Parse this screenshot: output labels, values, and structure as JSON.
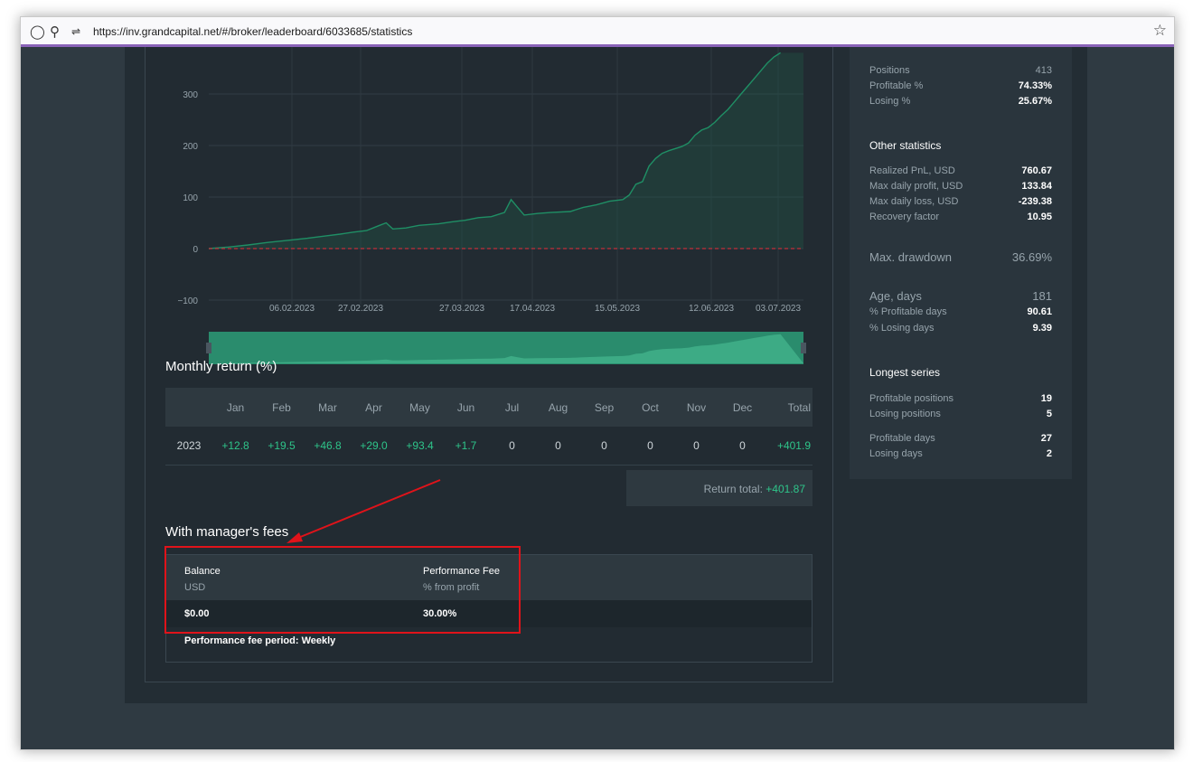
{
  "browser": {
    "url": "https://inv.grandcapital.net/#/broker/leaderboard/6033685/statistics"
  },
  "chart_data": {
    "type": "line",
    "yticks": [
      "300",
      "200",
      "100",
      "0",
      "−100"
    ],
    "xticks": [
      "06.02.2023",
      "27.02.2023",
      "27.03.2023",
      "17.04.2023",
      "15.05.2023",
      "12.06.2023",
      "03.07.2023"
    ],
    "ylim": [
      -100,
      380
    ],
    "grid": true,
    "series": [
      {
        "values": [
          [
            0,
            0
          ],
          [
            6,
            3
          ],
          [
            12,
            7
          ],
          [
            18,
            12
          ],
          [
            24,
            16
          ],
          [
            30,
            20
          ],
          [
            36,
            25
          ],
          [
            40,
            28
          ],
          [
            44,
            32
          ],
          [
            48,
            35
          ],
          [
            50,
            40
          ],
          [
            52,
            45
          ],
          [
            54,
            50
          ],
          [
            56,
            38
          ],
          [
            60,
            40
          ],
          [
            64,
            45
          ],
          [
            70,
            48
          ],
          [
            74,
            52
          ],
          [
            78,
            55
          ],
          [
            82,
            60
          ],
          [
            86,
            62
          ],
          [
            90,
            70
          ],
          [
            92,
            95
          ],
          [
            94,
            80
          ],
          [
            96,
            65
          ],
          [
            100,
            68
          ],
          [
            104,
            70
          ],
          [
            110,
            72
          ],
          [
            114,
            80
          ],
          [
            118,
            85
          ],
          [
            122,
            92
          ],
          [
            126,
            95
          ],
          [
            128,
            104
          ],
          [
            130,
            125
          ],
          [
            132,
            130
          ],
          [
            134,
            160
          ],
          [
            136,
            175
          ],
          [
            138,
            185
          ],
          [
            140,
            190
          ],
          [
            144,
            198
          ],
          [
            146,
            205
          ],
          [
            148,
            220
          ],
          [
            150,
            230
          ],
          [
            152,
            235
          ],
          [
            154,
            245
          ],
          [
            156,
            258
          ],
          [
            158,
            270
          ],
          [
            160,
            285
          ],
          [
            162,
            300
          ],
          [
            164,
            315
          ],
          [
            166,
            330
          ],
          [
            168,
            345
          ],
          [
            170,
            360
          ],
          [
            172,
            372
          ],
          [
            174,
            380
          ]
        ]
      },
      {
        "name": "",
        "values": [
          [
            0,
            0
          ],
          [
            181,
            0
          ]
        ],
        "style": "dashed"
      }
    ],
    "line_color": "#1f8f65",
    "zero_line_color": "#c0303a"
  },
  "monthly": {
    "title": "Monthly return (%)",
    "headers": [
      "",
      "Jan",
      "Feb",
      "Mar",
      "Apr",
      "May",
      "Jun",
      "Jul",
      "Aug",
      "Sep",
      "Oct",
      "Nov",
      "Dec",
      "Total"
    ],
    "row": [
      "2023",
      "+12.8",
      "+19.5",
      "+46.8",
      "+29.0",
      "+93.4",
      "+1.7",
      "0",
      "0",
      "0",
      "0",
      "0",
      "0",
      "+401.9"
    ],
    "return_total_label": "Return total:",
    "return_total_value": "+401.87"
  },
  "fees": {
    "title": "With manager's fees",
    "balance_label": "Balance",
    "balance_unit": "USD",
    "balance_value": "$0.00",
    "perf_label": "Performance Fee",
    "perf_unit": "% from profit",
    "perf_value": "30.00%",
    "period": "Performance fee period: Weekly"
  },
  "stats": {
    "positions_label": "Positions",
    "positions": "413",
    "profitable_label": "Profitable %",
    "profitable": "74.33%",
    "losing_label": "Losing %",
    "losing": "25.67%",
    "other_title": "Other statistics",
    "realized_label": "Realized PnL, USD",
    "realized": "760.67",
    "maxprofit_label": "Max daily profit, USD",
    "maxprofit": "133.84",
    "maxloss_label": "Max daily loss, USD",
    "maxloss": "-239.38",
    "recovery_label": "Recovery factor",
    "recovery": "10.95",
    "drawdown_label": "Max. drawdown",
    "drawdown": "36.69%",
    "age_label": "Age, days",
    "age": "181",
    "profdays_label": "% Profitable days",
    "profdays": "90.61",
    "losedays_label": "% Losing days",
    "losedays": "9.39",
    "series_title": "Longest series",
    "profpos_label": "Profitable positions",
    "profpos": "19",
    "losepos_label": "Losing positions",
    "losepos": "5",
    "profd_label": "Profitable days",
    "profd": "27",
    "losed_label": "Losing days",
    "losed": "2"
  }
}
